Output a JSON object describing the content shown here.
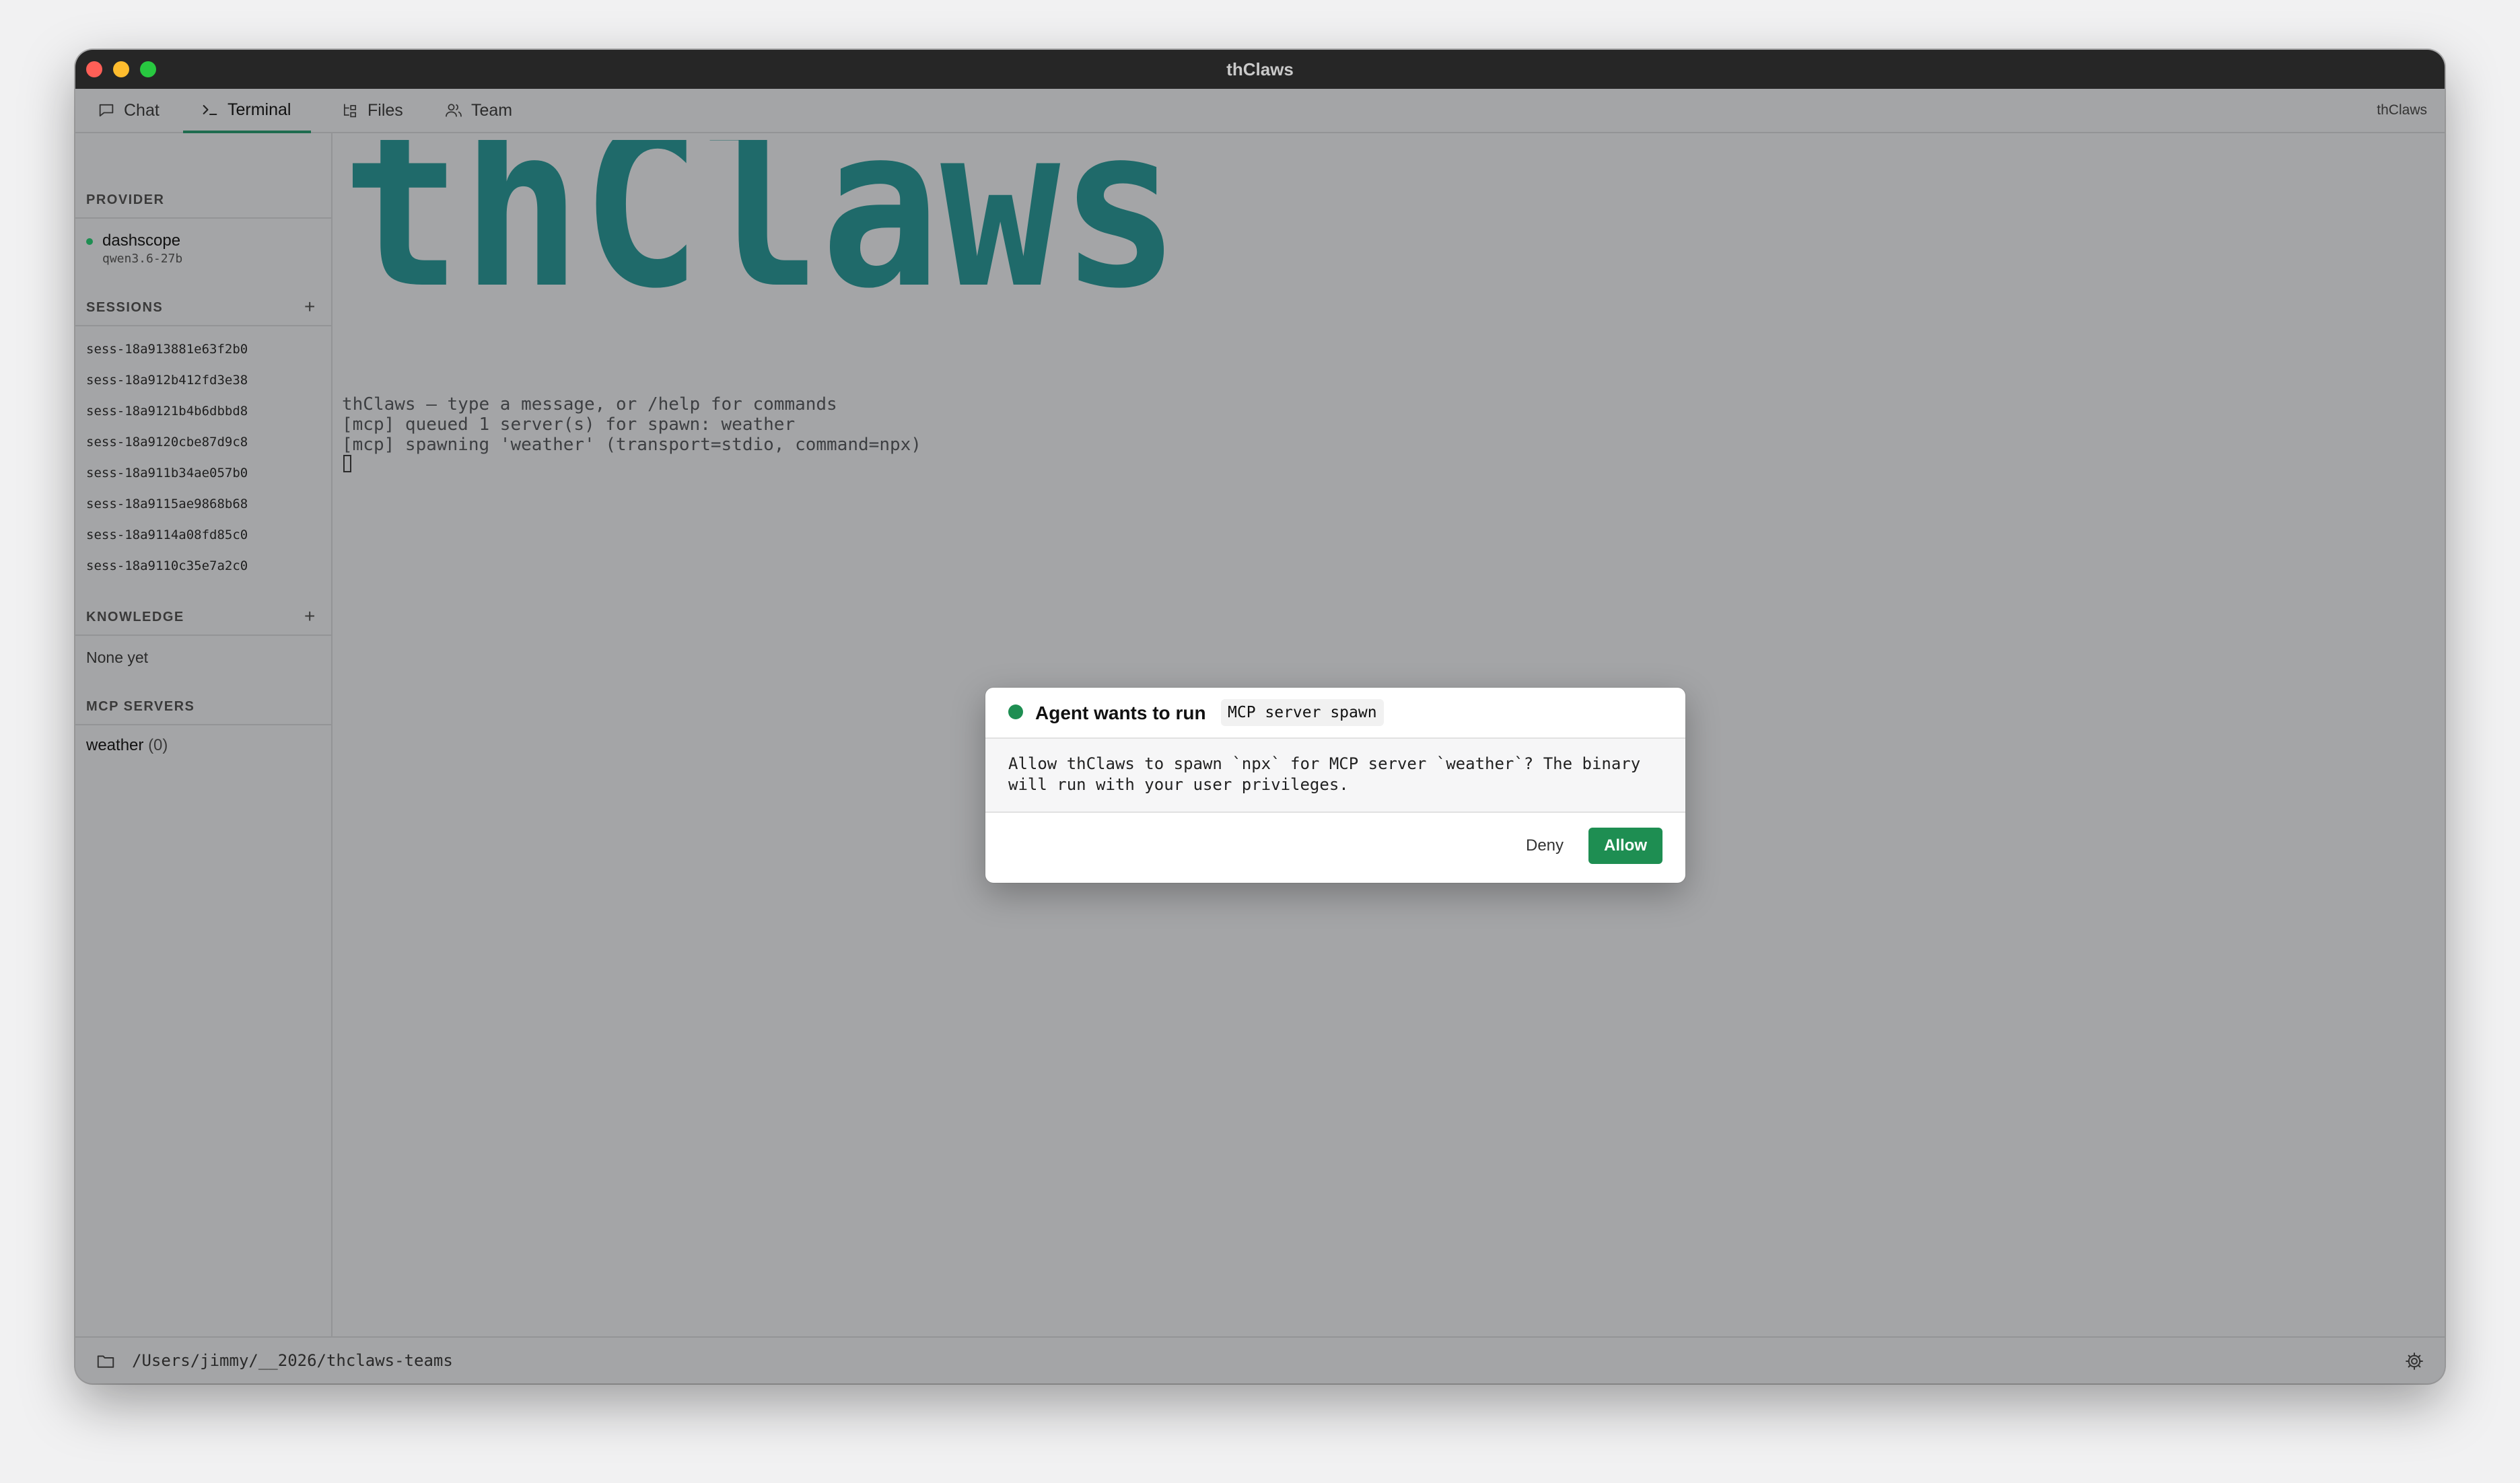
{
  "window": {
    "title": "thClaws"
  },
  "tabs": [
    {
      "label": "Chat",
      "icon": "chat-bubble-icon"
    },
    {
      "label": "Terminal",
      "icon": "terminal-prompt-icon",
      "active": true
    },
    {
      "label": "Files",
      "icon": "folder-tree-icon"
    },
    {
      "label": "Team",
      "icon": "people-icon"
    }
  ],
  "brand_label": "thClaws",
  "sidebar": {
    "provider": {
      "title": "PROVIDER",
      "name": "dashscope",
      "model": "qwen3.6-27b",
      "status_color": "#1e8e52"
    },
    "sessions": {
      "title": "SESSIONS",
      "add_label": "+",
      "items": [
        "sess-18a913881e63f2b0",
        "sess-18a912b412fd3e38",
        "sess-18a9121b4b6dbbd8",
        "sess-18a9120cbe87d9c8",
        "sess-18a911b34ae057b0",
        "sess-18a9115ae9868b68",
        "sess-18a9114a08fd85c0",
        "sess-18a9110c35e7a2c0"
      ]
    },
    "knowledge": {
      "title": "KNOWLEDGE",
      "add_label": "+",
      "empty_text": "None yet"
    },
    "mcp": {
      "title": "MCP SERVERS",
      "server_name": "weather",
      "server_count": "(0)"
    }
  },
  "terminal": {
    "banner_text": "thClaws",
    "banner_color": "#1f6a6a",
    "lines": [
      "thClaws — type a message, or /help for commands",
      "[mcp] queued 1 server(s) for spawn: weather",
      "[mcp] spawning 'weather' (transport=stdio, command=npx)"
    ]
  },
  "dialog": {
    "title": "Agent wants to run",
    "tool_chip": "MCP server spawn",
    "message": "Allow thClaws to spawn `npx` for MCP server `weather`? The binary will run with your user privileges.",
    "deny_label": "Deny",
    "allow_label": "Allow",
    "accent": "#1e8e52"
  },
  "statusbar": {
    "path": "/Users/jimmy/__2026/thclaws-teams",
    "folder_icon": "folder-icon",
    "settings_icon": "gear-icon"
  }
}
